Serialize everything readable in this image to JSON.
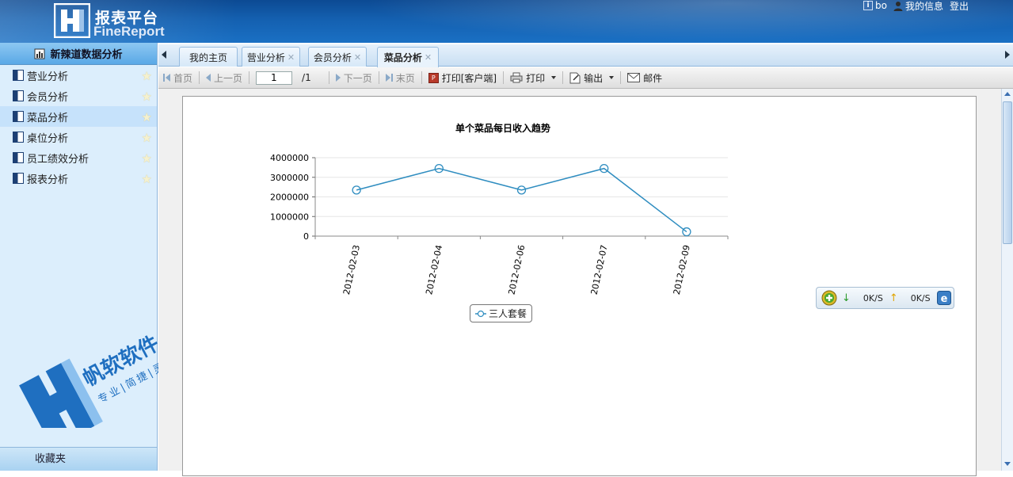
{
  "header": {
    "title": "报表平台",
    "subtitle": "FineReport",
    "user_name": "bo",
    "my_info": "我的信息",
    "logout": "登出"
  },
  "sidebar": {
    "title": "新辣道数据分析",
    "items": [
      {
        "label": "营业分析"
      },
      {
        "label": "会员分析"
      },
      {
        "label": "菜品分析"
      },
      {
        "label": "桌位分析"
      },
      {
        "label": "员工绩效分析"
      },
      {
        "label": "报表分析"
      }
    ],
    "active_index": 2,
    "favorites": "收藏夹",
    "brand_name": "帆软软件",
    "brand_slogan": "专业|简捷|灵活"
  },
  "tabs": [
    {
      "label": "我的主页",
      "closable": false
    },
    {
      "label": "营业分析",
      "closable": true
    },
    {
      "label": "会员分析",
      "closable": true
    },
    {
      "label": "菜品分析",
      "closable": true
    }
  ],
  "toolbar": {
    "first": "首页",
    "prev": "上一页",
    "page_value": "1",
    "page_total": "/1",
    "next": "下一页",
    "last": "末页",
    "print_client": "打印[客户端]",
    "print": "打印",
    "export": "输出",
    "mail": "邮件"
  },
  "netwidget": {
    "down": "0K/S",
    "up": "0K/S"
  },
  "chart_data": {
    "type": "line",
    "title": "单个菜品每日收入趋势",
    "categories": [
      "2012-02-03",
      "2012-02-04",
      "2012-02-06",
      "2012-02-07",
      "2012-02-09"
    ],
    "series": [
      {
        "name": "三人套餐",
        "values": [
          2350000,
          3450000,
          2350000,
          3450000,
          220000
        ],
        "color": "#2f8dc0"
      }
    ],
    "yticks": [
      "0",
      "1000000",
      "2000000",
      "3000000",
      "4000000"
    ],
    "ylim": [
      0,
      4000000
    ],
    "grid": true,
    "legend": "bottom"
  }
}
